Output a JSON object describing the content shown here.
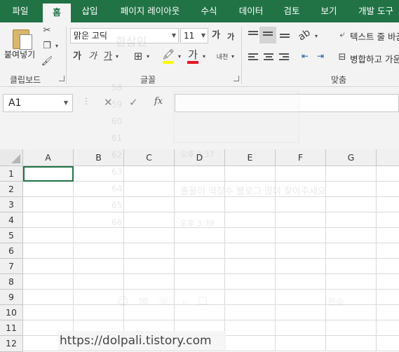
{
  "tabs": [
    {
      "label": "파일",
      "active": false
    },
    {
      "label": "홈",
      "active": true
    },
    {
      "label": "삽입",
      "active": false
    },
    {
      "label": "페이지 레이아웃",
      "active": false
    },
    {
      "label": "수식",
      "active": false
    },
    {
      "label": "데이터",
      "active": false
    },
    {
      "label": "검토",
      "active": false
    },
    {
      "label": "보기",
      "active": false
    },
    {
      "label": "개발 도구",
      "active": false
    }
  ],
  "ribbon": {
    "clipboard": {
      "paste_label": "붙여넣기",
      "group_label": "클립보드",
      "cut_icon": "scissors-icon",
      "copy_icon": "copy-icon",
      "format_painter_icon": "format-painter-icon"
    },
    "font": {
      "font_name": "맑은 고딕",
      "font_size": "11",
      "grow_label": "가",
      "shrink_label": "가",
      "bold_label": "가",
      "italic_label": "가",
      "underline_label": "가",
      "font_color_label": "가",
      "phonetic_label": "내천",
      "group_label": "글꼴",
      "fill_color": "#ffff00",
      "font_color": "#e81123"
    },
    "alignment": {
      "wrap_text_label": "텍스트 줄 바꿈",
      "merge_label": "병합하고 가운데 맞춤",
      "group_label": "맞춤"
    }
  },
  "formula_bar": {
    "name_box": "A1",
    "cancel_icon": "cancel-icon",
    "enter_icon": "check-icon",
    "fx_label": "fx",
    "value": ""
  },
  "sheet": {
    "columns": [
      "A",
      "B",
      "C",
      "D",
      "E",
      "F",
      "G"
    ],
    "rows": [
      "1",
      "2",
      "3",
      "4",
      "5",
      "6",
      "7",
      "8",
      "9",
      "10",
      "11",
      "12"
    ]
  },
  "watermark": "https://dolpali.tistory.com",
  "ghost": {
    "title": "한상민",
    "line_numbers": [
      "58",
      "59",
      "60",
      "61",
      "62",
      "63",
      "64",
      "65",
      "66"
    ],
    "time_1": "오후 3:37",
    "message": "졸꿀이 약장수 블로그 많이 찾아주세요",
    "time_2": "오후 3:39",
    "send_label": "전송"
  },
  "colors": {
    "accent": "#217346",
    "ribbon_bg": "#f3f3f3",
    "header_bg": "#f0f0f0"
  }
}
